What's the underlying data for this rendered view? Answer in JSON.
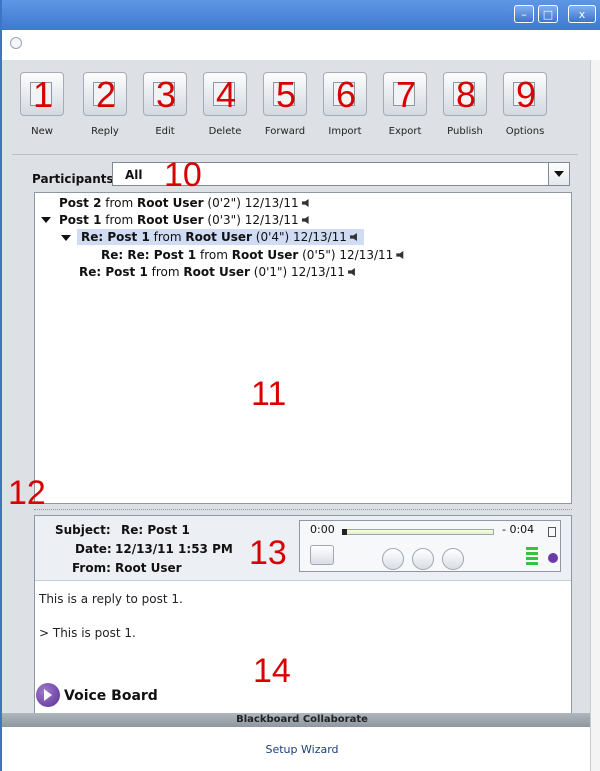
{
  "window": {
    "minimize": "–",
    "maximize": "□",
    "close": "x"
  },
  "toolbar": [
    {
      "num": "1",
      "label": "New",
      "icon": "new-post-icon"
    },
    {
      "num": "2",
      "label": "Reply",
      "icon": "reply-icon"
    },
    {
      "num": "3",
      "label": "Edit",
      "icon": "edit-icon"
    },
    {
      "num": "4",
      "label": "Delete",
      "icon": "delete-icon"
    },
    {
      "num": "5",
      "label": "Forward",
      "icon": "forward-icon"
    },
    {
      "num": "6",
      "label": "Import",
      "icon": "import-icon"
    },
    {
      "num": "7",
      "label": "Export",
      "icon": "export-icon"
    },
    {
      "num": "8",
      "label": "Publish",
      "icon": "publish-icon"
    },
    {
      "num": "9",
      "label": "Options",
      "icon": "options-gear-icon"
    }
  ],
  "participants": {
    "label": "Participants:",
    "value": "All",
    "annotation": "10"
  },
  "tree": {
    "annotation": "11",
    "items": [
      {
        "title": "Post 2",
        "from": " from ",
        "author": "Root User",
        "duration": " (0'2\") 12/13/11"
      },
      {
        "title": "Post 1",
        "from": " from ",
        "author": "Root User",
        "duration": " (0'3\") 12/13/11"
      },
      {
        "title": "Re: Post 1",
        "from": " from ",
        "author": "Root User",
        "duration": " (0'4\") 12/13/11"
      },
      {
        "title": "Re: Re: Post 1",
        "from": " from ",
        "author": "Root User",
        "duration": " (0'5\") 12/13/11"
      },
      {
        "title": "Re: Post 1",
        "from": " from ",
        "author": "Root User",
        "duration": " (0'1\") 12/13/11"
      }
    ]
  },
  "message": {
    "annotation_left": "12",
    "annotation_player": "13",
    "annotation_body": "14",
    "subject_label": "Subject:",
    "subject": "Re: Post 1",
    "date_label": "Date:",
    "date": "12/13/11 1:53 PM",
    "from_label": "From:",
    "from": "Root User",
    "player": {
      "elapsed": "0:00",
      "remaining": "- 0:04",
      "progress": 0
    },
    "body_lines": [
      "This is a reply to post 1.",
      "> This is post 1."
    ]
  },
  "voice_board": "Voice Board",
  "brand": "Blackboard Collaborate",
  "footer": "Setup Wizard",
  "colors": {
    "annotation": "#d80000",
    "titlebar": "#4a86df",
    "selection": "#cfdcf4"
  }
}
